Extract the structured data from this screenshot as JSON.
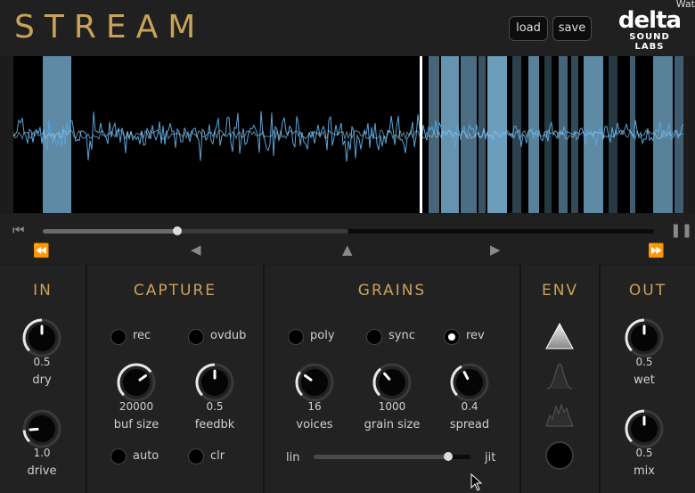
{
  "header": {
    "title": "STREAM",
    "corner_text": "Wat",
    "load_label": "load",
    "save_label": "save"
  },
  "brand": {
    "logo_word": "delta",
    "logo_sub": "SOUND LABS"
  },
  "transport": {
    "playhead_fraction": 0.22
  },
  "sections": {
    "in": {
      "title": "IN",
      "knobs": [
        {
          "value": "0.5",
          "label": "dry"
        },
        {
          "value": "1.0",
          "label": "drive"
        }
      ]
    },
    "capture": {
      "title": "CAPTURE",
      "toggles": [
        {
          "label": "rec"
        },
        {
          "label": "ovdub"
        },
        {
          "label": "auto"
        },
        {
          "label": "clr"
        }
      ],
      "knobs": [
        {
          "value": "20000",
          "label": "buf size"
        },
        {
          "value": "0.5",
          "label": "feedbk"
        }
      ]
    },
    "grains": {
      "title": "GRAINS",
      "options": [
        {
          "label": "poly",
          "selected": false
        },
        {
          "label": "sync",
          "selected": false
        },
        {
          "label": "rev",
          "selected": true
        }
      ],
      "knobs": [
        {
          "value": "16",
          "label": "voices"
        },
        {
          "value": "1000",
          "label": "grain size"
        },
        {
          "value": "0.4",
          "label": "spread"
        }
      ],
      "slider": {
        "left_label": "lin",
        "right_label": "jit",
        "value_fraction": 0.85
      }
    },
    "env": {
      "title": "ENV",
      "shapes": [
        "triangle-env-icon",
        "gaussian-env-icon",
        "noise-env-icon"
      ]
    },
    "out": {
      "title": "OUT",
      "knobs": [
        {
          "value": "0.5",
          "label": "wet"
        },
        {
          "value": "0.5",
          "label": "mix"
        }
      ]
    }
  },
  "colors": {
    "accent": "#c9a25a",
    "wave": "#5aa4d8",
    "grain": "#7fb8dc"
  }
}
